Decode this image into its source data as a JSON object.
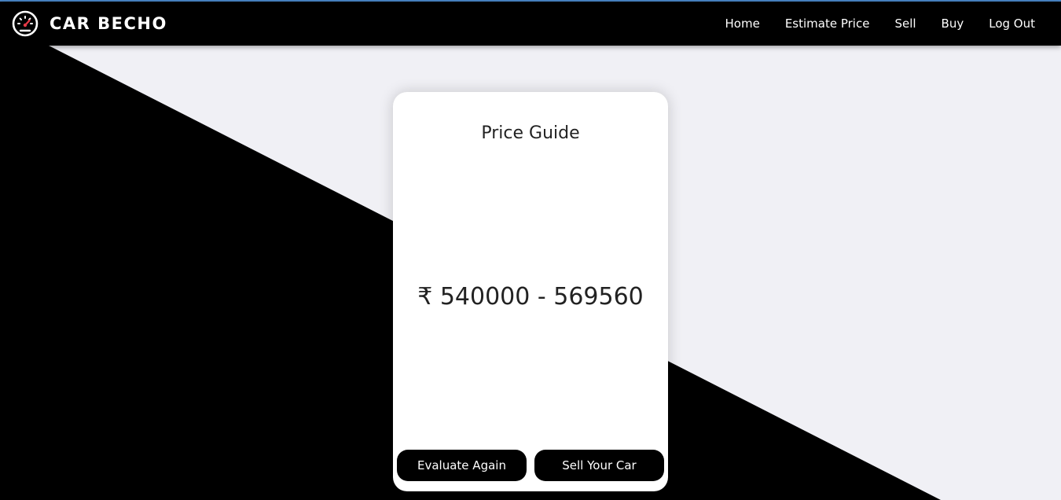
{
  "brand": {
    "name": "CAR BECHO",
    "logo_icon": "speedometer-icon"
  },
  "nav": {
    "items": [
      {
        "label": "Home"
      },
      {
        "label": "Estimate Price"
      },
      {
        "label": "Sell"
      },
      {
        "label": "Buy"
      },
      {
        "label": "Log Out"
      }
    ]
  },
  "card": {
    "title": "Price Guide",
    "price_range": "₹ 540000 - 569560",
    "buttons": {
      "evaluate_again": "Evaluate Again",
      "sell_your_car": "Sell Your Car"
    }
  },
  "colors": {
    "navbar": "#000000",
    "background_light": "#f0f0f5",
    "background_dark": "#000000",
    "button": "#000000",
    "accent_gauge": "#e63946"
  }
}
